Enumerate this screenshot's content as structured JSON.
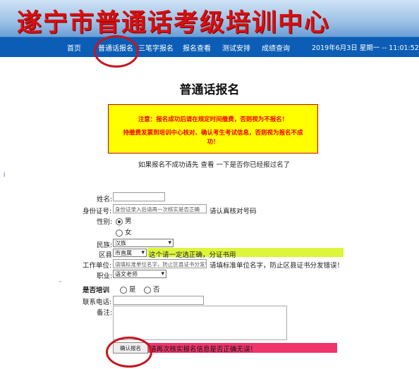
{
  "header": {
    "title": "遂宁市普通话考级培训中心"
  },
  "nav": {
    "items": [
      "首页",
      "普通话报名",
      "三笔字报名",
      "报名查看",
      "测试安排",
      "成绩查询"
    ],
    "datetime": "2019年6月3日 星期一 -- 11:01:52"
  },
  "page": {
    "title": "普通话报名",
    "notice_line1": "注意：报名成功后请在规定时间缴费，否则视为不报名！",
    "notice_line2a": "持缴费发票到培训中心核对、确认考生考试信息，否则视为报名不成",
    "notice_line2b": "功！",
    "hint_prefix": "如果报名不成功请先",
    "hint_link": "查看",
    "hint_suffix": "一下是否你已经报过名了",
    "side_mark": "I",
    "tiny_mark": "\""
  },
  "form": {
    "name_label": "姓名:",
    "id_label": "身份证号:",
    "id_placeholder": "身份证录入后请再一次核实是否正确",
    "id_note": "请认真核对号码",
    "gender_label": "性别:",
    "gender_male": "男",
    "gender_female": "女",
    "ethnic_label": "民族:",
    "ethnic_value": "汉族",
    "county_label": "区县",
    "county_value": "市直属",
    "county_note": "这个请一定选正确，分证书用",
    "work_label": "工作单位:",
    "work_placeholder": "请填标准单位名字，防止区县证书分发错误",
    "work_note": "请填标准单位名字，防止区县证书分发错误！",
    "job_label": "职业:",
    "job_value": "语文老师",
    "training_label": "是否培训",
    "training_yes": "是",
    "training_no": "否",
    "phone_label": "联系电话:",
    "remark_label": "备注:",
    "submit_label": "确认报名",
    "submit_note": "请再次核实报名信息是否正确无误！"
  },
  "colors": {
    "nav_bg": "#0b5db5",
    "title_red": "#d80f0f",
    "notice_bg": "#ffff00",
    "county_note_bg": "#ddf53b",
    "submit_note_bg": "#f0356b",
    "annotation_circle": "#c8141e"
  }
}
